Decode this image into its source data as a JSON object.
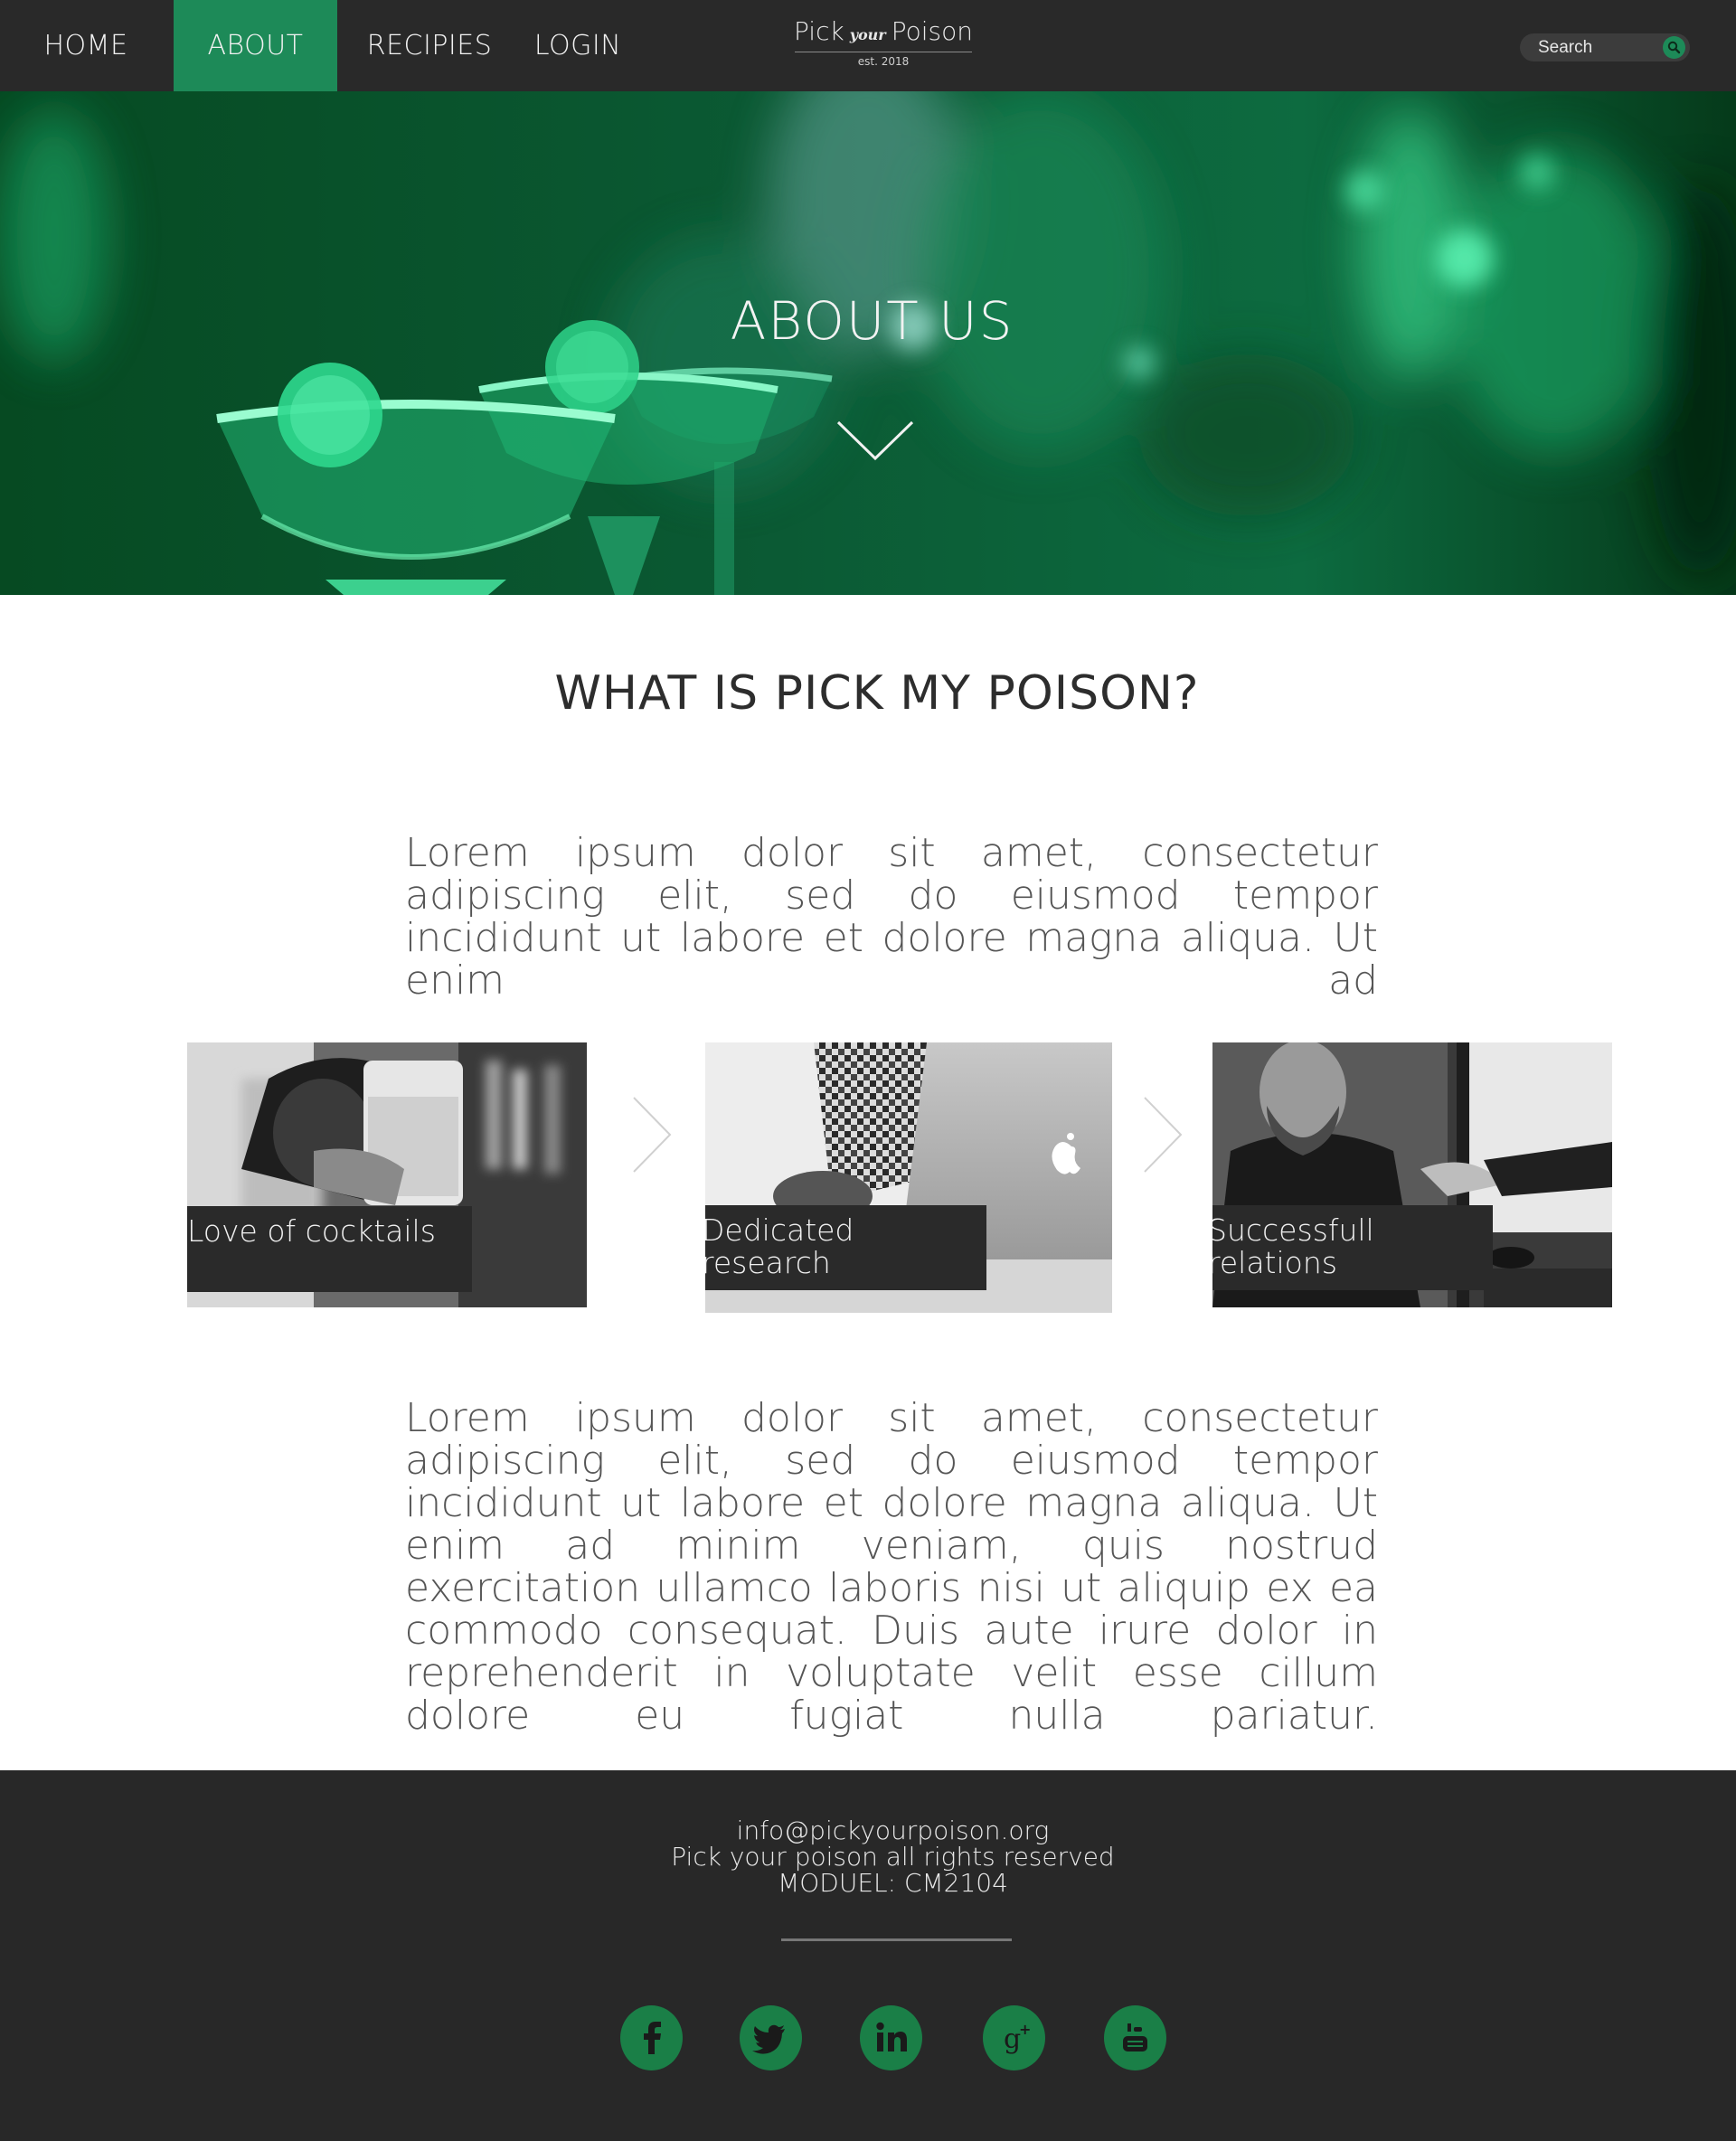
{
  "nav": {
    "items": [
      {
        "label": "HOME",
        "active": false
      },
      {
        "label": "ABOUT",
        "active": true
      },
      {
        "label": "RECIPIES",
        "active": false
      },
      {
        "label": "LOGIN",
        "active": false
      }
    ],
    "logo": {
      "part1": "Pick",
      "part2": "your",
      "part3": "Poison",
      "tagline": "est. 2018"
    },
    "search": {
      "placeholder": "Search",
      "icon": "search-icon"
    }
  },
  "hero": {
    "title": "ABOUT US",
    "icon": "chevron-down-icon"
  },
  "about": {
    "title": "WHAT IS PICK MY POISON?",
    "intro": "Lorem ipsum dolor sit amet, consectetur adipiscing elit, sed do eiusmod tempor incididunt ut labore et dolore magna aliqua. Ut enim ad",
    "body": "Lorem ipsum dolor sit amet, consectetur adipiscing elit, sed do eiusmod tempor incididunt ut labore et dolore magna aliqua. Ut enim ad minim veniam, quis nostrud exercitation ullamco laboris nisi ut aliquip ex ea commodo consequat. Duis aute irure dolor in reprehenderit in voluptate velit esse cillum dolore eu fugiat nulla pariatur."
  },
  "cards": [
    {
      "label": "Love of cocktails"
    },
    {
      "label": "Dedicated research"
    },
    {
      "label": "Successfull relations"
    }
  ],
  "footer": {
    "email": "info@pickyourpoison.org",
    "rights": "Pick your poison all rights reserved",
    "module": "MODUEL: CM2104",
    "social": [
      "facebook-icon",
      "twitter-icon",
      "linkedin-icon",
      "google-plus-icon",
      "youtube-icon"
    ]
  },
  "colors": {
    "accent": "#1d8a58",
    "dark": "#292929",
    "social": "#1a7f47"
  }
}
